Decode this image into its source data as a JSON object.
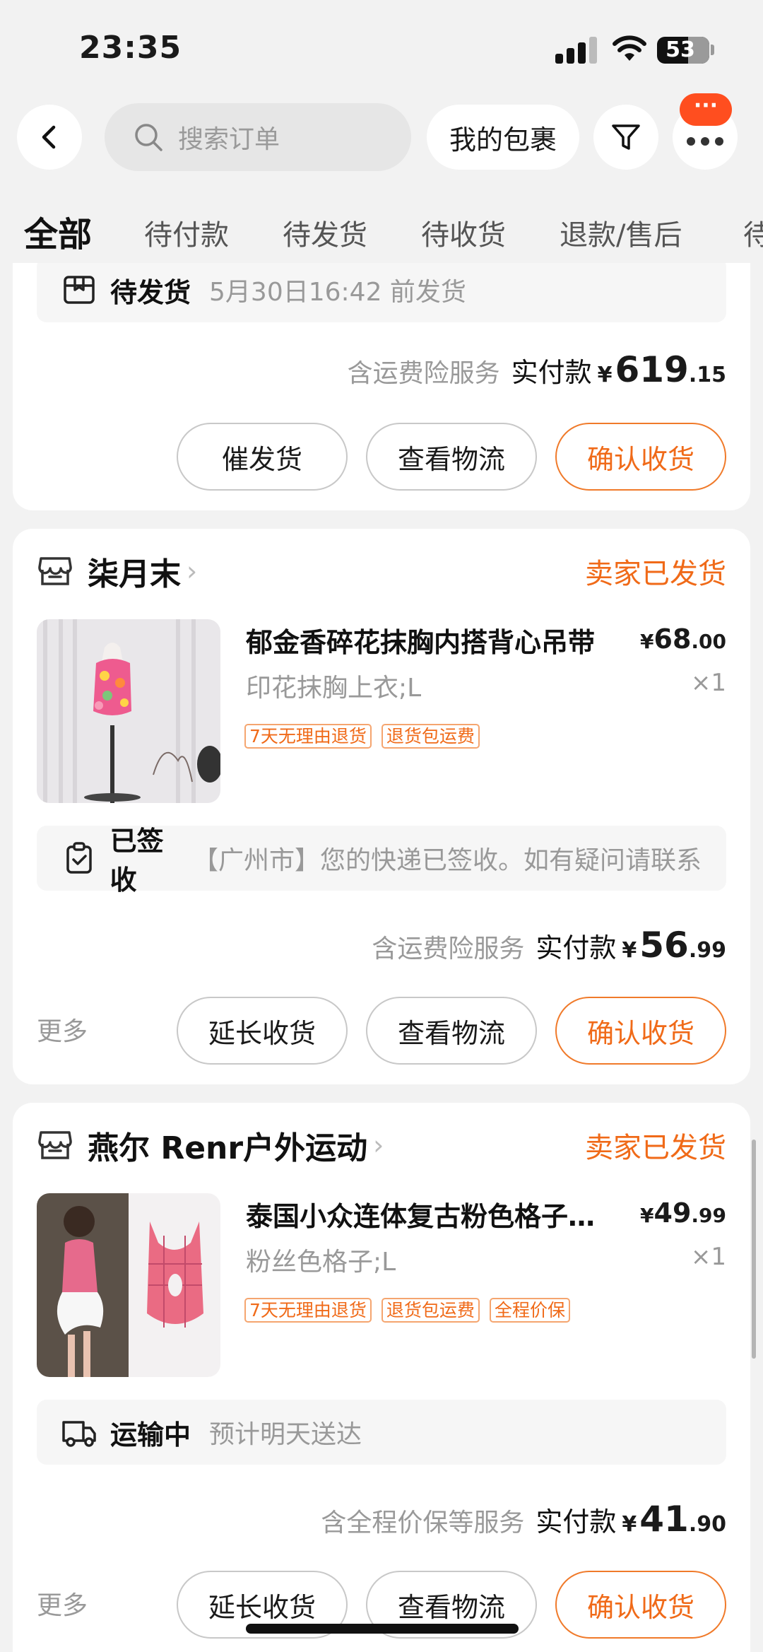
{
  "status_bar": {
    "time": "23:35",
    "battery": "53",
    "icons": [
      "signal-icon",
      "wifi-icon",
      "battery-icon"
    ]
  },
  "nav": {
    "search_placeholder": "搜索订单",
    "my_packages": "我的包裹",
    "more_badge": "···"
  },
  "tabs": [
    {
      "label": "全部",
      "active": true
    },
    {
      "label": "待付款"
    },
    {
      "label": "待发货"
    },
    {
      "label": "待收货"
    },
    {
      "label": "退款/售后"
    },
    {
      "label": "待"
    }
  ],
  "orders": [
    {
      "status_title": "待发货",
      "status_desc": "5月30日16:42 前发货",
      "pay_note": "含运费险服务",
      "pay_label": "实付款",
      "currency": "¥",
      "pay_int": "619",
      "pay_dec": ".15",
      "buttons": [
        "催发货",
        "查看物流",
        "确认收货"
      ]
    },
    {
      "shop_name": "柒月末",
      "shop_status": "卖家已发货",
      "product_title": "郁金香碎花抹胸内搭背心吊带",
      "price_currency": "¥",
      "price_int": "68",
      "price_dec": ".00",
      "spec": "印花抹胸上衣;L",
      "qty": "×1",
      "tags": [
        "7天无理由退货",
        "退货包运费"
      ],
      "status_title": "已签收",
      "status_desc": "【广州市】您的快递已签收。如有疑问请联系",
      "pay_note": "含运费险服务",
      "pay_label": "实付款",
      "currency": "¥",
      "pay_int": "56",
      "pay_dec": ".99",
      "more": "更多",
      "buttons": [
        "延长收货",
        "查看物流",
        "确认收货"
      ]
    },
    {
      "shop_name": "燕尔 Renr户外运动",
      "shop_status": "卖家已发货",
      "product_title": "泰国小众连体复古粉色格子泳衣",
      "price_currency": "¥",
      "price_int": "49",
      "price_dec": ".99",
      "spec": "粉丝色格子;L",
      "qty": "×1",
      "tags": [
        "7天无理由退货",
        "退货包运费",
        "全程价保"
      ],
      "status_title": "运输中",
      "status_desc": "预计明天送达",
      "pay_note": "含全程价保等服务",
      "pay_label": "实付款",
      "currency": "¥",
      "pay_int": "41",
      "pay_dec": ".90",
      "more": "更多",
      "buttons": [
        "延长收货",
        "查看物流",
        "确认收货"
      ]
    }
  ]
}
